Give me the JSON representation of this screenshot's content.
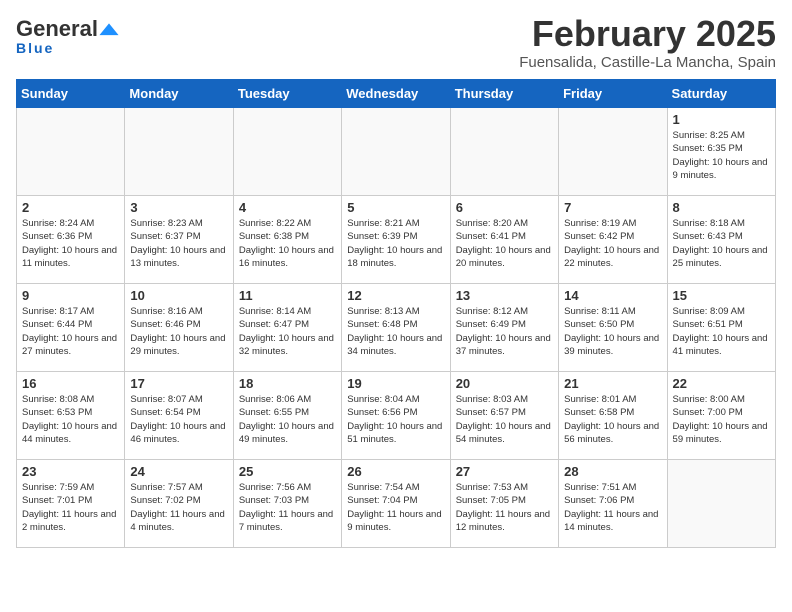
{
  "header": {
    "logo_general": "General",
    "logo_blue": "Blue",
    "month_title": "February 2025",
    "location": "Fuensalida, Castille-La Mancha, Spain"
  },
  "days_of_week": [
    "Sunday",
    "Monday",
    "Tuesday",
    "Wednesday",
    "Thursday",
    "Friday",
    "Saturday"
  ],
  "weeks": [
    [
      {
        "day": "",
        "text": ""
      },
      {
        "day": "",
        "text": ""
      },
      {
        "day": "",
        "text": ""
      },
      {
        "day": "",
        "text": ""
      },
      {
        "day": "",
        "text": ""
      },
      {
        "day": "",
        "text": ""
      },
      {
        "day": "1",
        "text": "Sunrise: 8:25 AM\nSunset: 6:35 PM\nDaylight: 10 hours and 9 minutes."
      }
    ],
    [
      {
        "day": "2",
        "text": "Sunrise: 8:24 AM\nSunset: 6:36 PM\nDaylight: 10 hours and 11 minutes."
      },
      {
        "day": "3",
        "text": "Sunrise: 8:23 AM\nSunset: 6:37 PM\nDaylight: 10 hours and 13 minutes."
      },
      {
        "day": "4",
        "text": "Sunrise: 8:22 AM\nSunset: 6:38 PM\nDaylight: 10 hours and 16 minutes."
      },
      {
        "day": "5",
        "text": "Sunrise: 8:21 AM\nSunset: 6:39 PM\nDaylight: 10 hours and 18 minutes."
      },
      {
        "day": "6",
        "text": "Sunrise: 8:20 AM\nSunset: 6:41 PM\nDaylight: 10 hours and 20 minutes."
      },
      {
        "day": "7",
        "text": "Sunrise: 8:19 AM\nSunset: 6:42 PM\nDaylight: 10 hours and 22 minutes."
      },
      {
        "day": "8",
        "text": "Sunrise: 8:18 AM\nSunset: 6:43 PM\nDaylight: 10 hours and 25 minutes."
      }
    ],
    [
      {
        "day": "9",
        "text": "Sunrise: 8:17 AM\nSunset: 6:44 PM\nDaylight: 10 hours and 27 minutes."
      },
      {
        "day": "10",
        "text": "Sunrise: 8:16 AM\nSunset: 6:46 PM\nDaylight: 10 hours and 29 minutes."
      },
      {
        "day": "11",
        "text": "Sunrise: 8:14 AM\nSunset: 6:47 PM\nDaylight: 10 hours and 32 minutes."
      },
      {
        "day": "12",
        "text": "Sunrise: 8:13 AM\nSunset: 6:48 PM\nDaylight: 10 hours and 34 minutes."
      },
      {
        "day": "13",
        "text": "Sunrise: 8:12 AM\nSunset: 6:49 PM\nDaylight: 10 hours and 37 minutes."
      },
      {
        "day": "14",
        "text": "Sunrise: 8:11 AM\nSunset: 6:50 PM\nDaylight: 10 hours and 39 minutes."
      },
      {
        "day": "15",
        "text": "Sunrise: 8:09 AM\nSunset: 6:51 PM\nDaylight: 10 hours and 41 minutes."
      }
    ],
    [
      {
        "day": "16",
        "text": "Sunrise: 8:08 AM\nSunset: 6:53 PM\nDaylight: 10 hours and 44 minutes."
      },
      {
        "day": "17",
        "text": "Sunrise: 8:07 AM\nSunset: 6:54 PM\nDaylight: 10 hours and 46 minutes."
      },
      {
        "day": "18",
        "text": "Sunrise: 8:06 AM\nSunset: 6:55 PM\nDaylight: 10 hours and 49 minutes."
      },
      {
        "day": "19",
        "text": "Sunrise: 8:04 AM\nSunset: 6:56 PM\nDaylight: 10 hours and 51 minutes."
      },
      {
        "day": "20",
        "text": "Sunrise: 8:03 AM\nSunset: 6:57 PM\nDaylight: 10 hours and 54 minutes."
      },
      {
        "day": "21",
        "text": "Sunrise: 8:01 AM\nSunset: 6:58 PM\nDaylight: 10 hours and 56 minutes."
      },
      {
        "day": "22",
        "text": "Sunrise: 8:00 AM\nSunset: 7:00 PM\nDaylight: 10 hours and 59 minutes."
      }
    ],
    [
      {
        "day": "23",
        "text": "Sunrise: 7:59 AM\nSunset: 7:01 PM\nDaylight: 11 hours and 2 minutes."
      },
      {
        "day": "24",
        "text": "Sunrise: 7:57 AM\nSunset: 7:02 PM\nDaylight: 11 hours and 4 minutes."
      },
      {
        "day": "25",
        "text": "Sunrise: 7:56 AM\nSunset: 7:03 PM\nDaylight: 11 hours and 7 minutes."
      },
      {
        "day": "26",
        "text": "Sunrise: 7:54 AM\nSunset: 7:04 PM\nDaylight: 11 hours and 9 minutes."
      },
      {
        "day": "27",
        "text": "Sunrise: 7:53 AM\nSunset: 7:05 PM\nDaylight: 11 hours and 12 minutes."
      },
      {
        "day": "28",
        "text": "Sunrise: 7:51 AM\nSunset: 7:06 PM\nDaylight: 11 hours and 14 minutes."
      },
      {
        "day": "",
        "text": ""
      }
    ]
  ]
}
